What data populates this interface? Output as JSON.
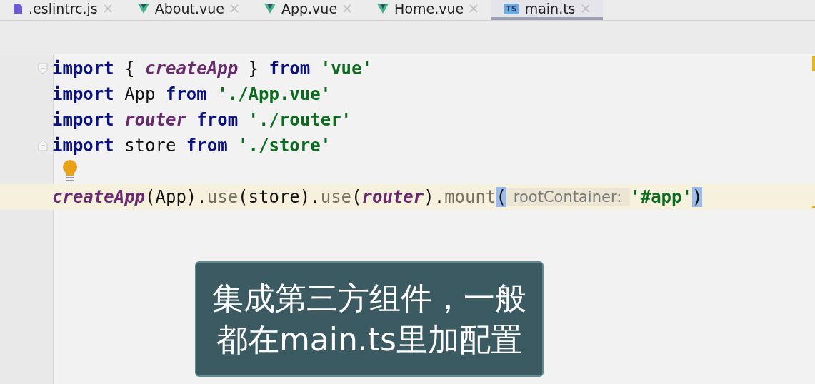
{
  "tabs": [
    {
      "label": ".eslintrc.js",
      "kind": "js",
      "selected": false
    },
    {
      "label": "About.vue",
      "kind": "vue",
      "selected": false
    },
    {
      "label": "App.vue",
      "kind": "vue",
      "selected": false
    },
    {
      "label": "Home.vue",
      "kind": "vue",
      "selected": false
    },
    {
      "label": "main.ts",
      "kind": "ts",
      "badge": "TS",
      "selected": true
    }
  ],
  "code": {
    "lines": [
      {
        "fold": true,
        "current": false,
        "tokens": [
          {
            "text": "import",
            "kind": "keyword"
          },
          {
            "text": " { ",
            "kind": "plain"
          },
          {
            "text": "createApp",
            "kind": "italic"
          },
          {
            "text": " } ",
            "kind": "plain"
          },
          {
            "text": "from ",
            "kind": "keyword"
          },
          {
            "text": "'vue'",
            "kind": "string"
          }
        ]
      },
      {
        "fold": false,
        "current": false,
        "tokens": [
          {
            "text": "import",
            "kind": "keyword"
          },
          {
            "text": " App ",
            "kind": "plain"
          },
          {
            "text": "from ",
            "kind": "keyword"
          },
          {
            "text": "'./App.vue'",
            "kind": "string"
          }
        ]
      },
      {
        "fold": false,
        "current": false,
        "tokens": [
          {
            "text": "import ",
            "kind": "keyword"
          },
          {
            "text": "router ",
            "kind": "italic"
          },
          {
            "text": "from ",
            "kind": "keyword"
          },
          {
            "text": "'./router'",
            "kind": "string"
          }
        ]
      },
      {
        "fold": true,
        "current": false,
        "tokens": [
          {
            "text": "import",
            "kind": "keyword"
          },
          {
            "text": " store ",
            "kind": "plain"
          },
          {
            "text": "from ",
            "kind": "keyword"
          },
          {
            "text": "'./store'",
            "kind": "string"
          }
        ]
      },
      {
        "fold": false,
        "current": false,
        "bulb": true
      },
      {
        "fold": false,
        "current": true,
        "tokens": [
          {
            "text": "createApp",
            "kind": "italic"
          },
          {
            "text": "(App).",
            "kind": "plain"
          },
          {
            "text": "use",
            "kind": "method"
          },
          {
            "text": "(store).",
            "kind": "plain"
          },
          {
            "text": "use",
            "kind": "method"
          },
          {
            "text": "(",
            "kind": "plain"
          },
          {
            "text": "router",
            "kind": "italic"
          },
          {
            "text": ").",
            "kind": "plain"
          },
          {
            "text": "mount",
            "kind": "method"
          },
          {
            "text": "(",
            "kind": "match"
          },
          {
            "text": "rootContainer:",
            "kind": "hint"
          },
          {
            "text": "'#app'",
            "kind": "string"
          },
          {
            "text": ")",
            "kind": "match"
          }
        ]
      }
    ]
  },
  "caption": {
    "lines": [
      "集成第三方组件，一般",
      "都在main.ts里加配置"
    ]
  }
}
